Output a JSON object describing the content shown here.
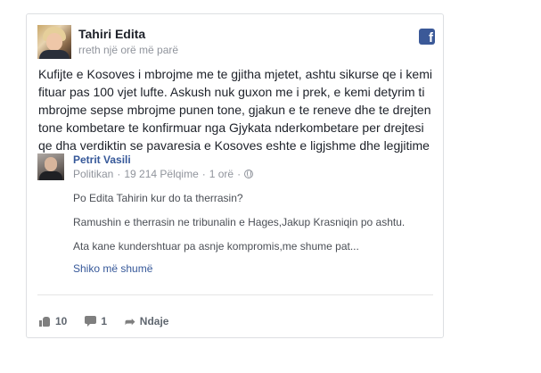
{
  "post": {
    "author": "Tahiri Edita",
    "time": "rreth një orë më parë",
    "text": "Kufijte e Kosoves i mbrojme me te gjitha mjetet, ashtu sikurse qe i kemi fituar pas 100 vjet lufte. Askush nuk guxon me i prek, e kemi detyrim ti mbrojme sepse mbrojme punen tone, gjakun e te reneve dhe te drejten tone kombetare te konfirmuar nga Gjykata nderkombetare per drejtesi qe dha verdiktin se pavaresia e Kosoves eshte e ligjshme dhe legjitime",
    "platform_icon": "facebook-icon"
  },
  "shared": {
    "name": "Petrit Vasili",
    "category": "Politikan",
    "followers": "19 214 Pëlqime",
    "age": "1 orë",
    "sep": "·",
    "lines": [
      "Po Edita Tahirin kur do ta therrasin?",
      "Ramushin e therrasin ne tribunalin e Hages,Jakup Krasniqin po ashtu.",
      "Ata kane kundershtuar pa asnje kompromis,me shume pat..."
    ],
    "see_more": "Shiko më shumë"
  },
  "footer": {
    "likes": "10",
    "comments": "1",
    "share_label": "Ndaje"
  },
  "colors": {
    "link": "#365899",
    "facebook_blue": "#3b5998",
    "muted": "#90949c"
  }
}
